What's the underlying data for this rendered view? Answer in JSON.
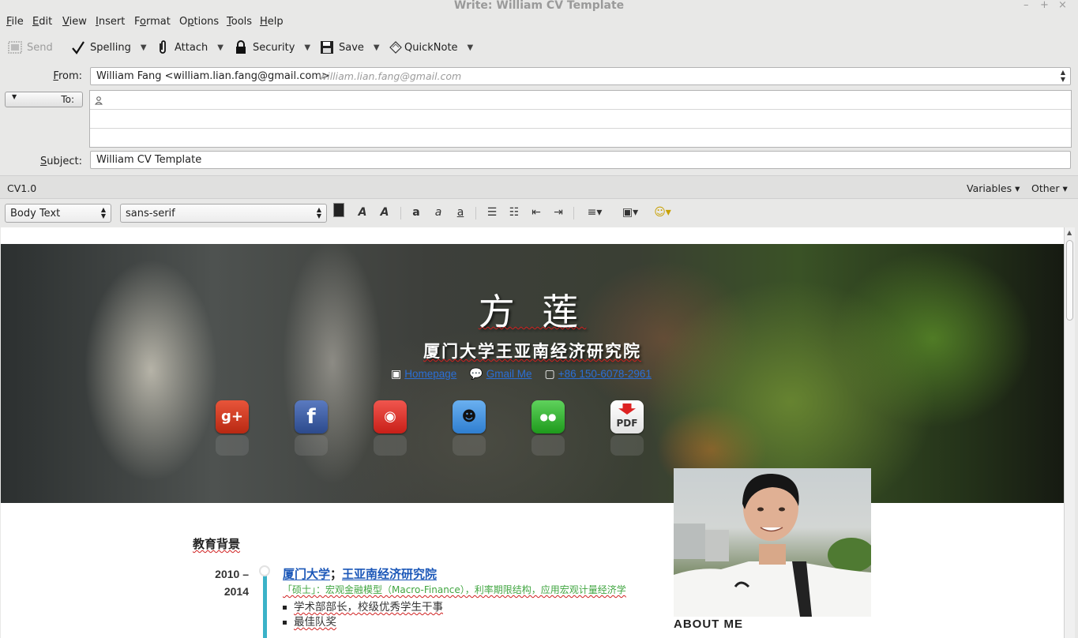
{
  "window": {
    "title": "Write: William CV Template",
    "controls": [
      "–",
      "+",
      "×"
    ]
  },
  "menubar": [
    {
      "label": "File",
      "ul": "F",
      "rest": "ile"
    },
    {
      "label": "Edit",
      "ul": "E",
      "rest": "dit"
    },
    {
      "label": "View",
      "ul": "V",
      "rest": "iew"
    },
    {
      "label": "Insert",
      "ul": "I",
      "rest": "nsert"
    },
    {
      "label": "Format",
      "ul": "o",
      "pre": "F",
      "rest": "rmat"
    },
    {
      "label": "Options",
      "ul": "p",
      "pre": "O",
      "rest": "tions"
    },
    {
      "label": "Tools",
      "ul": "T",
      "rest": "ools"
    },
    {
      "label": "Help",
      "ul": "H",
      "rest": "elp"
    }
  ],
  "toolbar": {
    "send": "Send",
    "spelling": "Spelling",
    "attach": "Attach",
    "security": "Security",
    "save": "Save",
    "quicknote": "QuickNote"
  },
  "header": {
    "from_label": "From:",
    "from_value": "William Fang <william.lian.fang@gmail.com>",
    "from_ghost": "william.lian.fang@gmail.com",
    "to_label": "To:",
    "subject_label": "Subject:",
    "subject_value": "William CV Template"
  },
  "variables_bar": {
    "name": "CV1.0",
    "variables": "Variables",
    "other": "Other"
  },
  "format_bar": {
    "paragraph_style": "Body Text",
    "font": "sans-serif"
  },
  "cv": {
    "name": "方 莲",
    "school": "厦门大学王亚南经济研究院",
    "links": [
      {
        "icon": "homepage-icon",
        "label": "Homepage"
      },
      {
        "icon": "chat-bubble-icon",
        "label": "Gmail Me"
      },
      {
        "icon": "phone-icon",
        "label": "+86 150-6078-2961"
      }
    ],
    "social": [
      {
        "name": "google-plus",
        "text": "g+",
        "color": "#d23a22"
      },
      {
        "name": "facebook",
        "text": "f",
        "color": "#3b5998"
      },
      {
        "name": "weibo",
        "text": "◉",
        "color": "#e0312a"
      },
      {
        "name": "qq",
        "text": "☻",
        "color": "#3d8fe0"
      },
      {
        "name": "wechat",
        "text": "●●",
        "color": "#2fb52e"
      },
      {
        "name": "pdf",
        "text": "PDF",
        "color": "#f4f4f4"
      }
    ],
    "about_label": "ABOUT ME",
    "section_title": "教育背景",
    "years_start": "2010 –",
    "years_end": "2014",
    "school_a": "厦门大学",
    "school_sep": "；",
    "school_b": "王亚南经济研究院",
    "degree": "「硕士」：宏观金融模型（Macro-Finance），利率期限结构，应用宏观计量经济学",
    "bullets": [
      "学术部部长，校级优秀学生干事",
      "最佳队奖"
    ]
  }
}
